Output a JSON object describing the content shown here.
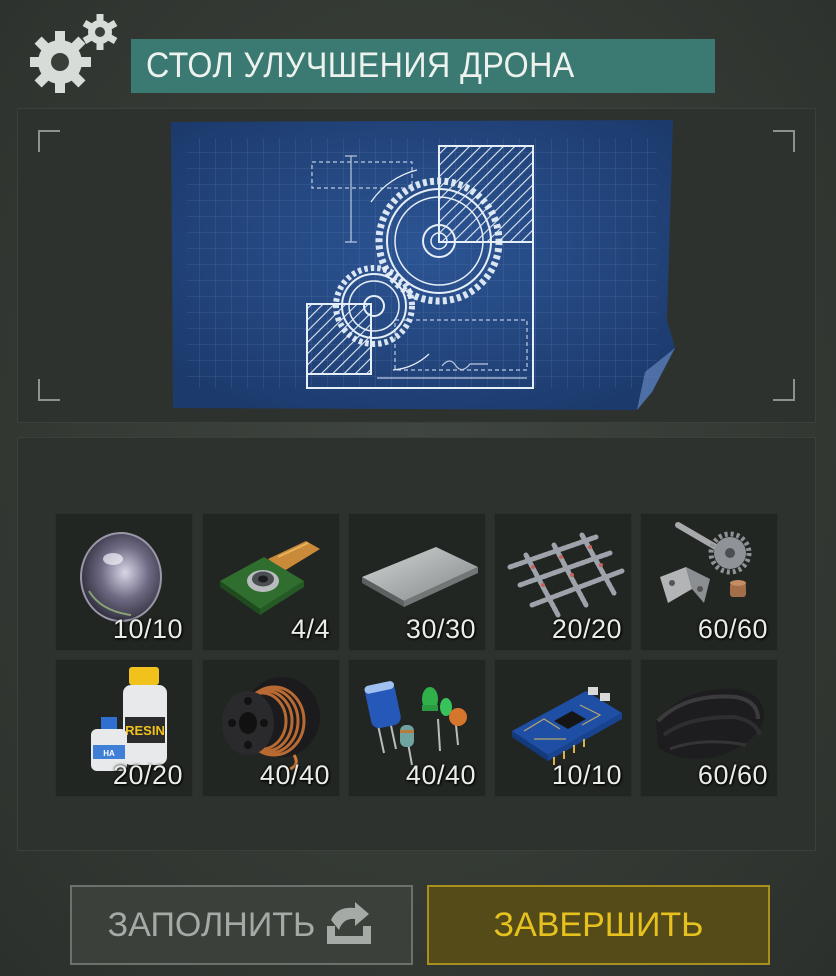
{
  "header": {
    "title": "СТОЛ УЛУЧШЕНИЯ ДРОНА",
    "icon": "gears-icon"
  },
  "blueprint": {
    "icon": "blueprint-gears-drawing"
  },
  "items": [
    {
      "name": "lens",
      "count": "10/10"
    },
    {
      "name": "camera-module",
      "count": "4/4"
    },
    {
      "name": "metal-plate",
      "count": "30/30"
    },
    {
      "name": "rebar",
      "count": "20/20"
    },
    {
      "name": "mechanical-parts",
      "count": "60/60"
    },
    {
      "name": "resin",
      "count": "20/20"
    },
    {
      "name": "copper-wire",
      "count": "40/40"
    },
    {
      "name": "electronic-components",
      "count": "40/40"
    },
    {
      "name": "circuit-board",
      "count": "10/10"
    },
    {
      "name": "leather",
      "count": "60/60"
    }
  ],
  "buttons": {
    "fill_label": "ЗАПОЛНИТЬ",
    "finish_label": "ЗАВЕРШИТЬ"
  },
  "colors": {
    "title_bg": "#3a7a72",
    "finish_border": "#a8901c",
    "finish_text": "#e7c21f",
    "blueprint_bg": "#23457e"
  }
}
